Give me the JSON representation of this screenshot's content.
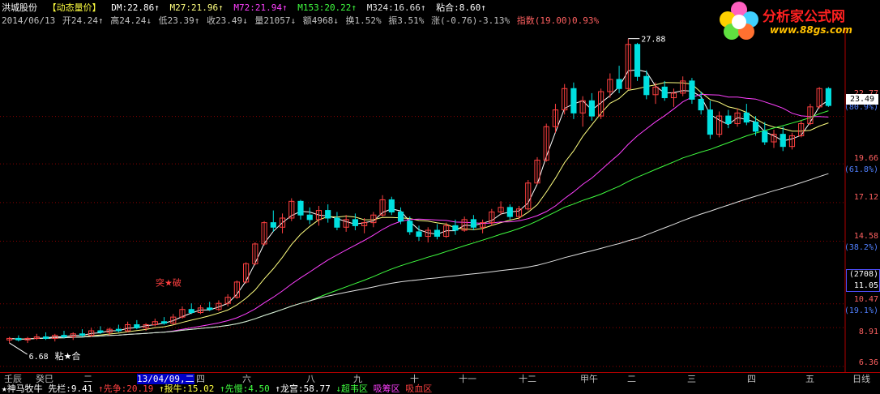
{
  "header": {
    "stock_name": "洪城股份",
    "indicator_name": "【动态量价】",
    "dm": "DM:22.86↑",
    "m27": "M27:21.96↑",
    "m72": "M72:21.94↑",
    "m153": "M153:20.22↑",
    "m324": "M324:16.66↑",
    "nianhe": "粘合:8.60↑"
  },
  "info": {
    "date": "2014/06/13",
    "open": "开24.24↑",
    "high": "高24.24↓",
    "low": "低23.39↑",
    "close": "收23.49↓",
    "volume": "量21057↓",
    "amount": "额4968↓",
    "turnover": "换1.52%",
    "amplitude": "振3.51%",
    "change": "涨(-0.76)-3.13%",
    "index": "指数(19.00)0.93%"
  },
  "price_labels": {
    "high_label": "27.88",
    "low_label": "6.68",
    "nianhe_star": "粘★合",
    "tupo_star": "突★破"
  },
  "right_axis": {
    "p1": "22.77",
    "current": "23.49",
    "pct1": "(80.9%)",
    "p2": "19.66",
    "pct2": "(61.8%)",
    "p3": "17.12",
    "p4": "14.58",
    "pct3": "(38.2%)",
    "box1": "(2708)",
    "box2": "11.05",
    "p5": "10.47",
    "pct4": "(19.1%)",
    "p6": "8.91",
    "p7": "6.36"
  },
  "date_axis": {
    "labels": [
      "壬辰",
      "癸巳",
      "二",
      "13/04/09,二",
      "四",
      "六",
      "八",
      "九",
      "十",
      "十一",
      "十二",
      "甲午",
      "二",
      "三",
      "四",
      "五"
    ],
    "period": "日线"
  },
  "bottom_row": {
    "item1": "★神马牧牛",
    "item2": "先栏:9.41",
    "item3": "↑先争:20.19",
    "item4": "↑报牛:15.02",
    "item5": "↑先慢:4.50",
    "item6": "↑龙宫:58.77",
    "item7": "↓超韦区",
    "item8": "吸筹区",
    "item9": "吸血区"
  },
  "logo": {
    "text": "分析家公式网",
    "url": "www.88gs.com"
  },
  "colors": {
    "up_candle": "#ff4040",
    "down_candle": "#00e0e0",
    "dm_line": "#ffffff",
    "m27_line": "#ffff80",
    "m72_line": "#ff40ff",
    "m153_line": "#40ff40",
    "m324_line": "#e0e0e0",
    "grid": "#8b0000"
  },
  "chart_data": {
    "type": "candlestick",
    "ylim": [
      6.36,
      28.5
    ],
    "candles": [
      [
        8.1,
        8.3,
        7.9,
        8.2
      ],
      [
        8.2,
        8.4,
        8.0,
        8.1
      ],
      [
        8.1,
        8.3,
        7.9,
        8.2
      ],
      [
        8.2,
        8.5,
        8.1,
        8.3
      ],
      [
        8.3,
        8.6,
        8.1,
        8.2
      ],
      [
        8.2,
        8.5,
        8.0,
        8.4
      ],
      [
        8.4,
        8.7,
        8.2,
        8.3
      ],
      [
        8.3,
        8.6,
        8.1,
        8.5
      ],
      [
        8.5,
        8.8,
        8.3,
        8.4
      ],
      [
        8.4,
        8.9,
        8.3,
        8.7
      ],
      [
        8.7,
        9.0,
        8.5,
        8.6
      ],
      [
        8.6,
        8.9,
        8.4,
        8.8
      ],
      [
        8.8,
        9.1,
        8.6,
        8.7
      ],
      [
        8.7,
        9.3,
        8.6,
        9.1
      ],
      [
        9.1,
        9.4,
        8.8,
        8.9
      ],
      [
        8.9,
        9.2,
        8.7,
        9.1
      ],
      [
        9.1,
        9.5,
        9.0,
        9.3
      ],
      [
        9.3,
        9.6,
        9.1,
        9.2
      ],
      [
        9.2,
        9.8,
        9.1,
        9.6
      ],
      [
        9.6,
        10.3,
        9.5,
        10.1
      ],
      [
        10.1,
        10.5,
        9.8,
        9.9
      ],
      [
        9.9,
        10.4,
        9.8,
        10.2
      ],
      [
        10.2,
        10.6,
        10.0,
        10.1
      ],
      [
        10.1,
        10.7,
        10.0,
        10.5
      ],
      [
        10.5,
        11.1,
        10.3,
        10.9
      ],
      [
        10.9,
        12.0,
        10.8,
        11.9
      ],
      [
        11.9,
        13.2,
        11.8,
        13.1
      ],
      [
        13.1,
        14.5,
        13.0,
        14.4
      ],
      [
        14.4,
        15.9,
        14.3,
        15.8
      ],
      [
        15.8,
        16.6,
        15.2,
        15.5
      ],
      [
        15.5,
        16.4,
        15.1,
        16.1
      ],
      [
        16.1,
        17.4,
        15.9,
        17.2
      ],
      [
        17.2,
        17.3,
        16.0,
        16.3
      ],
      [
        16.3,
        16.8,
        15.7,
        16.0
      ],
      [
        16.0,
        16.9,
        15.6,
        16.6
      ],
      [
        16.6,
        17.0,
        15.8,
        16.1
      ],
      [
        16.1,
        16.5,
        15.3,
        15.5
      ],
      [
        15.5,
        16.3,
        15.2,
        16.0
      ],
      [
        16.0,
        16.4,
        15.3,
        15.6
      ],
      [
        15.6,
        16.1,
        15.1,
        15.8
      ],
      [
        15.8,
        16.5,
        15.5,
        16.3
      ],
      [
        16.3,
        17.6,
        16.2,
        17.3
      ],
      [
        17.3,
        17.5,
        16.3,
        16.5
      ],
      [
        16.5,
        16.8,
        15.7,
        15.9
      ],
      [
        15.9,
        16.2,
        15.0,
        15.2
      ],
      [
        15.2,
        15.6,
        14.6,
        14.9
      ],
      [
        14.9,
        15.5,
        14.5,
        15.3
      ],
      [
        15.3,
        15.7,
        14.7,
        14.9
      ],
      [
        14.9,
        15.8,
        14.8,
        15.6
      ],
      [
        15.6,
        16.0,
        15.0,
        15.3
      ],
      [
        15.3,
        16.2,
        15.2,
        16.0
      ],
      [
        16.0,
        16.3,
        15.3,
        15.5
      ],
      [
        15.5,
        16.0,
        15.1,
        15.8
      ],
      [
        15.8,
        16.7,
        15.6,
        16.5
      ],
      [
        16.5,
        17.2,
        16.3,
        16.8
      ],
      [
        16.8,
        17.0,
        16.0,
        16.2
      ],
      [
        16.2,
        16.9,
        16.0,
        16.7
      ],
      [
        16.7,
        18.6,
        16.6,
        18.4
      ],
      [
        18.4,
        20.1,
        18.3,
        19.9
      ],
      [
        19.9,
        22.3,
        19.8,
        22.1
      ],
      [
        22.1,
        23.6,
        21.7,
        23.2
      ],
      [
        23.2,
        24.9,
        22.9,
        24.6
      ],
      [
        24.6,
        25.0,
        22.6,
        23.0
      ],
      [
        23.0,
        24.1,
        22.1,
        23.8
      ],
      [
        23.8,
        24.3,
        22.5,
        22.8
      ],
      [
        22.8,
        24.6,
        22.6,
        24.4
      ],
      [
        24.4,
        25.6,
        24.0,
        25.2
      ],
      [
        25.2,
        26.1,
        24.3,
        24.6
      ],
      [
        24.6,
        27.88,
        24.5,
        27.5
      ],
      [
        27.5,
        27.6,
        25.1,
        25.4
      ],
      [
        25.4,
        25.8,
        23.9,
        24.2
      ],
      [
        24.2,
        25.0,
        23.6,
        24.7
      ],
      [
        24.7,
        25.1,
        23.8,
        24.0
      ],
      [
        24.0,
        24.6,
        23.4,
        24.3
      ],
      [
        24.3,
        25.4,
        24.1,
        25.1
      ],
      [
        25.1,
        25.3,
        23.6,
        23.9
      ],
      [
        23.9,
        24.4,
        22.9,
        23.2
      ],
      [
        23.2,
        23.8,
        21.3,
        21.6
      ],
      [
        21.6,
        23.1,
        21.4,
        22.8
      ],
      [
        22.8,
        23.2,
        22.0,
        22.3
      ],
      [
        22.3,
        23.3,
        22.1,
        23.0
      ],
      [
        23.0,
        23.6,
        22.2,
        22.4
      ],
      [
        22.4,
        22.8,
        21.5,
        21.8
      ],
      [
        21.8,
        22.4,
        20.9,
        21.1
      ],
      [
        21.1,
        21.9,
        20.7,
        21.6
      ],
      [
        21.6,
        22.1,
        20.5,
        20.8
      ],
      [
        20.8,
        21.7,
        20.6,
        21.5
      ],
      [
        21.5,
        22.5,
        21.4,
        22.3
      ],
      [
        22.3,
        23.6,
        22.2,
        23.4
      ],
      [
        23.4,
        24.7,
        23.3,
        24.6
      ],
      [
        24.6,
        24.7,
        23.4,
        23.49
      ]
    ],
    "ma_labels": [
      "DM",
      "M27",
      "M72",
      "M153",
      "M324"
    ]
  }
}
